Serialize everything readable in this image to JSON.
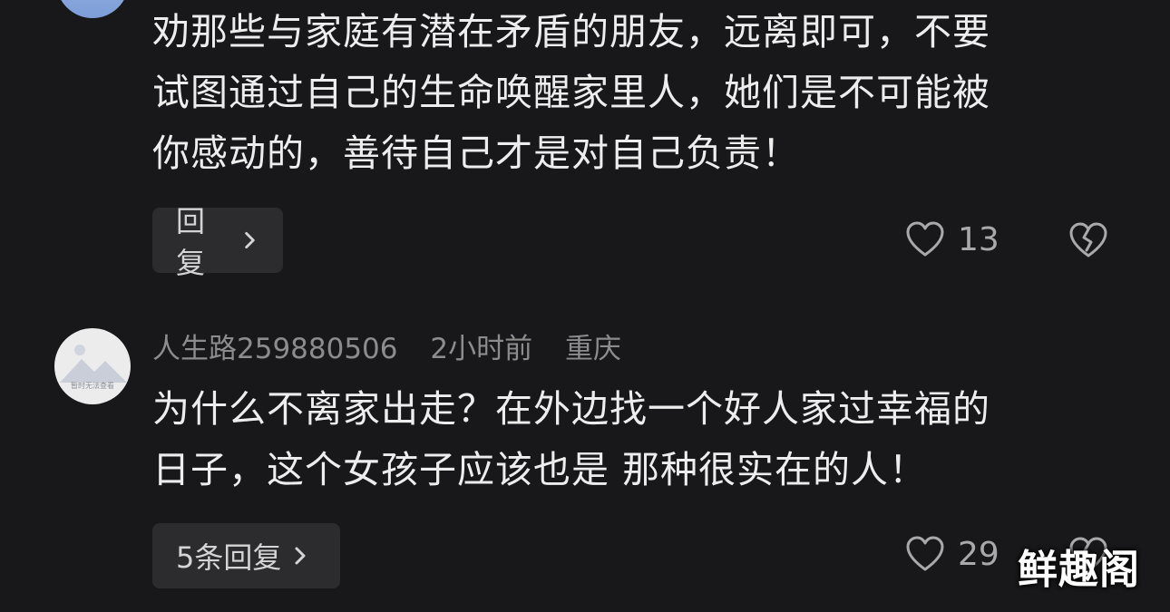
{
  "comment1": {
    "lines": [
      "劝那些与家庭有潜在矛盾的朋友，远离即可，不要",
      "试图通过自己的生命唤醒家里人，她们是不可能被",
      "你感动的，善待自己才是对自己负责！"
    ],
    "reply_label": "回复",
    "likes": "13"
  },
  "comment2": {
    "username": "人生路259880506",
    "time": "2小时前",
    "location": "重庆",
    "avatar_caption": "暂时无法查看",
    "lines": [
      "为什么不离家出走？在外边找一个好人家过幸福的",
      "日子，这个女孩子应该也是 那种很实在的人！"
    ],
    "reply_label": "5条回复",
    "likes": "29"
  },
  "watermark": "鲜趣阁",
  "icons": {
    "like": "heart-outline-icon",
    "dislike": "broken-heart-icon",
    "chevron": "chevron-right-icon"
  }
}
